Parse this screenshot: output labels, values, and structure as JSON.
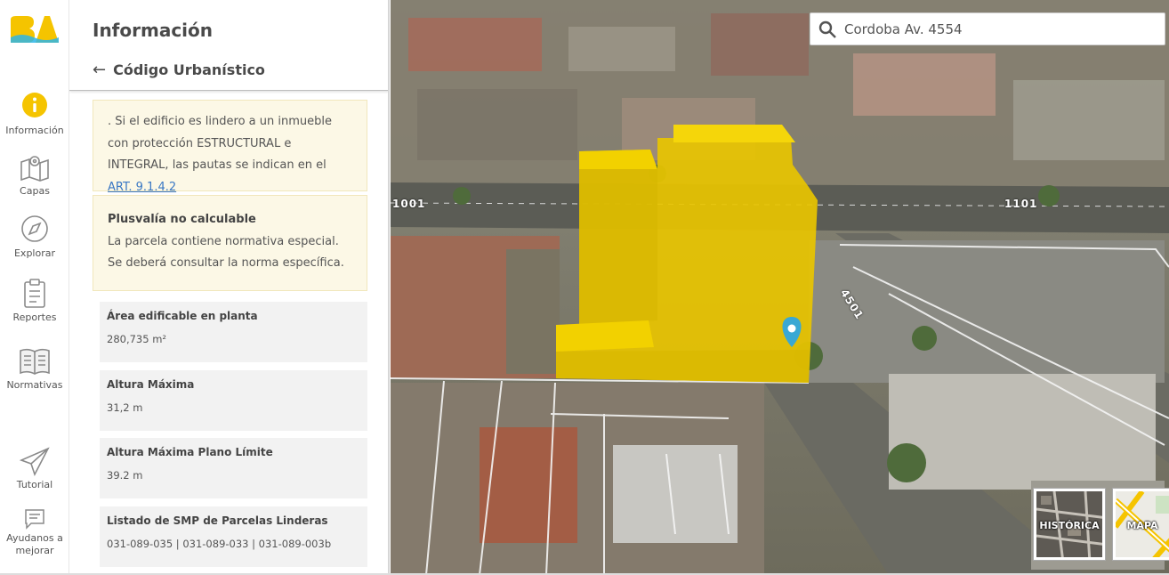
{
  "nav": {
    "logo_text": "BA",
    "items": [
      {
        "label": "Información",
        "icon": "info-icon"
      },
      {
        "label": "Capas",
        "icon": "map-layers-icon"
      },
      {
        "label": "Explorar",
        "icon": "compass-icon"
      },
      {
        "label": "Reportes",
        "icon": "clipboard-icon"
      },
      {
        "label": "Normativas",
        "icon": "book-icon"
      },
      {
        "label": "Tutorial",
        "icon": "paper-plane-icon"
      },
      {
        "label": "Ayudanos a mejorar",
        "icon": "feedback-icon"
      }
    ],
    "accent_color": "#f5c400"
  },
  "panel": {
    "title": "Información",
    "back_label": "Código Urbanístico",
    "note1": {
      "text": ". Si el edificio es lindero a un inmueble con protección ESTRUCTURAL e INTEGRAL, las pautas se indican en el ",
      "link": "ART. 9.1.4.2"
    },
    "note2": {
      "title": "Plusvalía no calculable",
      "text": "La parcela contiene normativa especial. Se deberá consultar la norma específica."
    },
    "stats": [
      {
        "label": "Área edificable en planta",
        "value": "280,735 m²"
      },
      {
        "label": "Altura Máxima",
        "value": "31,2 m"
      },
      {
        "label": "Altura Máxima Plano Límite",
        "value": "39.2 m"
      },
      {
        "label": "Listado de SMP de Parcelas Linderas",
        "value": "031-089-035 | 031-089-033 | 031-089-003b"
      }
    ]
  },
  "map": {
    "search_value": "Cordoba Av. 4554",
    "street_labels": [
      "1001",
      "1101",
      "4501"
    ],
    "layer_thumbs": [
      "HISTÓRICA",
      "MAPA"
    ],
    "building_color": "#e8c400",
    "pin_color": "#39a8d4"
  }
}
